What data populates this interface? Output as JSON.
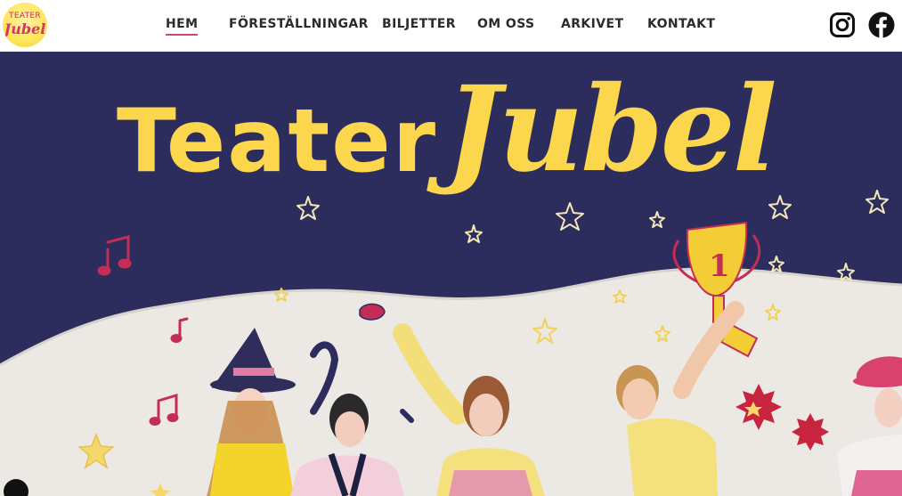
{
  "logo": {
    "top_text": "TEATER",
    "bottom_text": "Jubel"
  },
  "nav": {
    "items": [
      {
        "label": "HEM",
        "active": true
      },
      {
        "label": "FÖRESTÄLLNINGAR",
        "active": false
      },
      {
        "label": "BILJETTER",
        "active": false
      },
      {
        "label": "OM OSS",
        "active": false
      },
      {
        "label": "ARKIVET",
        "active": false
      },
      {
        "label": "KONTAKT",
        "active": false
      }
    ]
  },
  "social": {
    "instagram_icon": "instagram-icon",
    "facebook_icon": "facebook-icon"
  },
  "hero": {
    "title_word1": "Teater",
    "title_word2": "Jubel",
    "trophy_number": "1"
  },
  "colors": {
    "hero_bg": "#2c2d5c",
    "title_yellow": "#fcd74d",
    "accent_pink": "#d4437a",
    "wall": "#ece9e4"
  }
}
